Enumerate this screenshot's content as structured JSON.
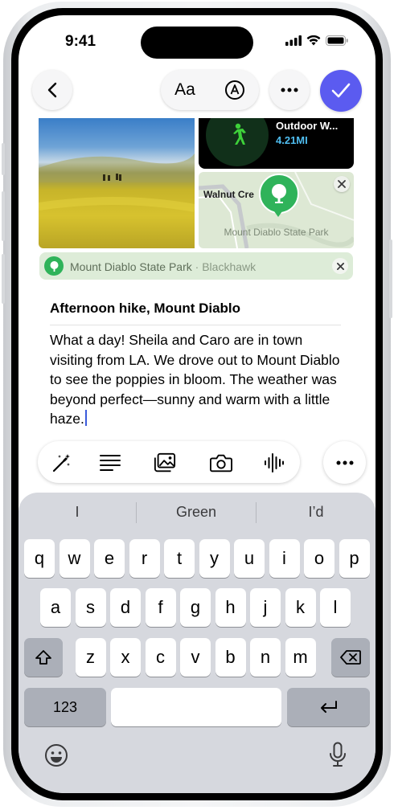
{
  "status_bar": {
    "time": "9:41"
  },
  "toolbar": {
    "format_label": "Aa"
  },
  "attachments": {
    "workout_title": "Outdoor W...",
    "workout_distance": "4.21MI",
    "map_place": "Walnut Cre",
    "map_label": "Mount Diablo State Park"
  },
  "location_chip": {
    "name": "Mount Diablo State Park",
    "separator": " · ",
    "locality": "Blackhawk"
  },
  "note": {
    "title": "Afternoon hike, Mount Diablo",
    "body": "What a day! Sheila and Caro are in town visiting from LA. We drove out to Mount Diablo to see the poppies in bloom. The weather was beyond perfect—sunny and warm with a little haze."
  },
  "keyboard": {
    "suggestions": [
      "I",
      "Green",
      "I’d"
    ],
    "row1": [
      "q",
      "w",
      "e",
      "r",
      "t",
      "y",
      "u",
      "i",
      "o",
      "p"
    ],
    "row2": [
      "a",
      "s",
      "d",
      "f",
      "g",
      "h",
      "j",
      "k",
      "l"
    ],
    "row3": [
      "z",
      "x",
      "c",
      "v",
      "b",
      "n",
      "m"
    ],
    "numbers_label": "123"
  },
  "colors": {
    "accent": "#5b5bf0",
    "workout_green": "#3ed13a",
    "map_green": "#2fb35a",
    "caret": "#3b5bdb"
  }
}
